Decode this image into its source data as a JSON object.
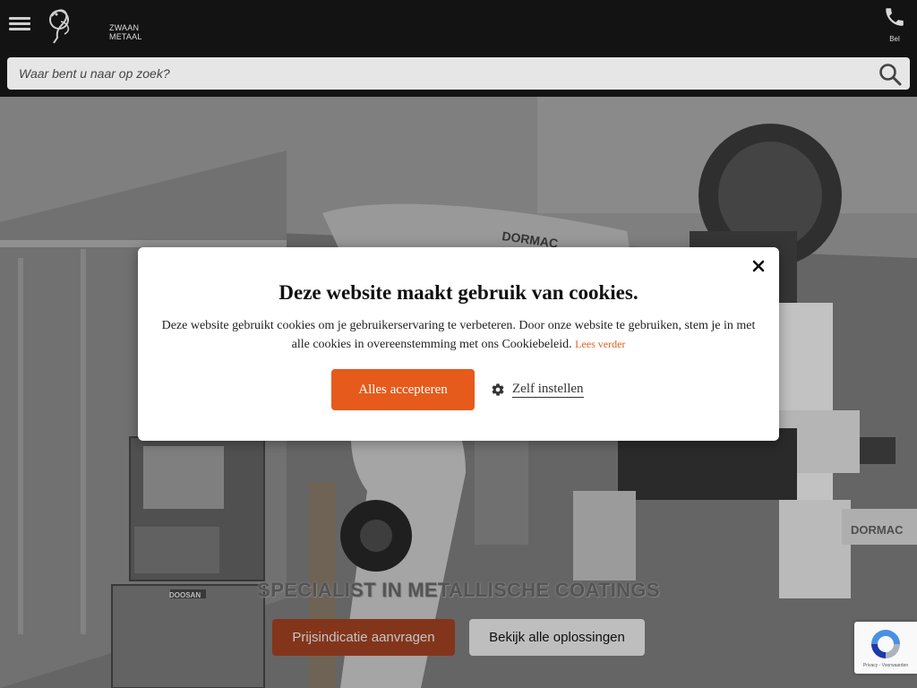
{
  "header": {
    "menu_icon": "hamburger-menu-icon",
    "logo_text_line1": "ZWAAN",
    "logo_text_line2": "METAAL",
    "call_label": "Bel",
    "call_icon": "phone-icon"
  },
  "search": {
    "placeholder": "Waar bent u naar op zoek?",
    "value": "",
    "icon": "search-icon"
  },
  "hero": {
    "title": "SPECIALIST IN METALLISCHE COATINGS",
    "primary_cta": "Prijsindicatie aanvragen",
    "secondary_cta": "Bekijk alle oplossingen",
    "photo_text_brand": "DORMAC",
    "photo_text_brand2": "DORMAC",
    "photo_text_machine": "DOOSAN"
  },
  "cookie_modal": {
    "title": "Deze website maakt gebruik van cookies.",
    "text": "Deze website gebruikt cookies om je gebruikerservaring te verbeteren. Door onze website te gebruiken, stem je in met alle cookies in overeenstemming met ons Cookiebeleid.",
    "read_more": "Lees verder",
    "accept_label": "Alles accepteren",
    "settings_label": "Zelf instellen",
    "close_icon": "close-icon",
    "settings_icon": "gear-icon",
    "accent_color": "#e65a1c"
  },
  "recaptcha": {
    "text": "Privacy - Voorwaarden"
  }
}
